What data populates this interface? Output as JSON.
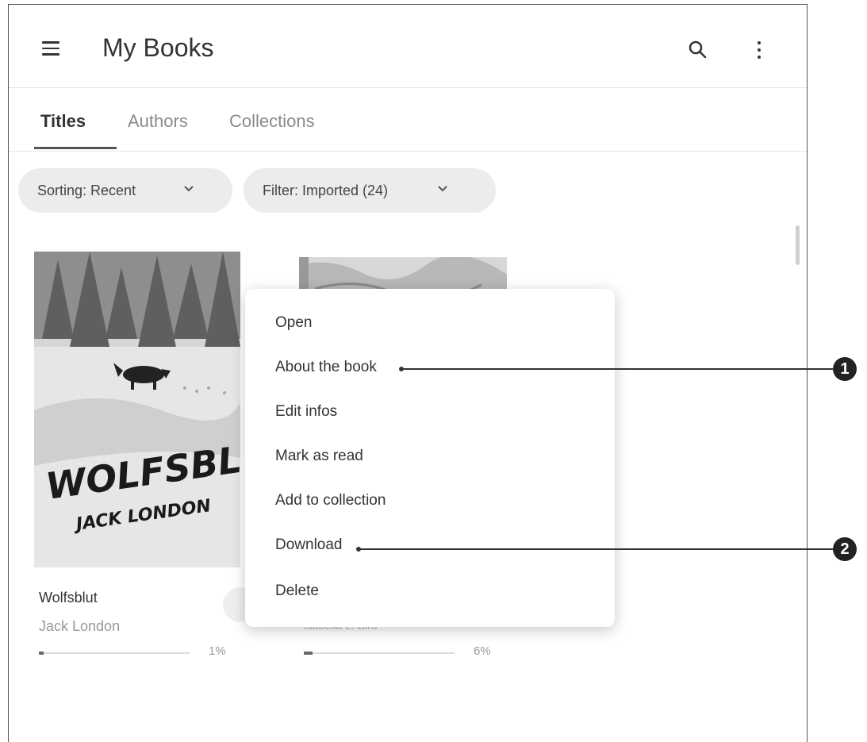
{
  "appbar": {
    "title": "My Books",
    "menu_icon": "hamburger-icon",
    "search_icon": "search-icon",
    "more_icon": "more-vertical-icon"
  },
  "tabs": [
    {
      "label": "Titles",
      "active": true
    },
    {
      "label": "Authors",
      "active": false
    },
    {
      "label": "Collections",
      "active": false
    }
  ],
  "filters": {
    "sorting": "Sorting: Recent",
    "filter": "Filter: Imported (24)"
  },
  "books": [
    {
      "title": "Wolfsblut",
      "author": "Jack London",
      "progress_pct": 1,
      "progress_label": "1%",
      "cover_title": "WOLFSBLUT",
      "cover_author": "JACK LONDON"
    },
    {
      "title": "",
      "author": "Isabella L. Bird",
      "progress_pct": 6,
      "progress_label": "6%"
    }
  ],
  "context_menu": {
    "items": [
      "Open",
      "About the book",
      "Edit infos",
      "Mark as read",
      "Add to collection",
      "Download",
      "Delete"
    ]
  },
  "callouts": [
    {
      "number": "1",
      "target": "About the book"
    },
    {
      "number": "2",
      "target": "Download"
    }
  ],
  "colors": {
    "text": "#333333",
    "muted": "#999999",
    "chip": "#ececec",
    "callout": "#222222"
  }
}
